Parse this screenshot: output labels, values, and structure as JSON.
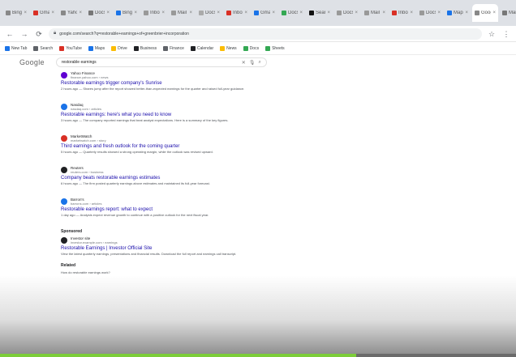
{
  "colors": {
    "link": "#1a0dab",
    "progress": "#7ccd39"
  },
  "browser": {
    "tabs": [
      {
        "label": "Bing",
        "color": "#888888"
      },
      {
        "label": "Gmail",
        "color": "#d93025"
      },
      {
        "label": "Yahoo",
        "color": "#888888"
      },
      {
        "label": "Docs",
        "color": "#777777"
      },
      {
        "label": "Bing",
        "color": "#1a73e8"
      },
      {
        "label": "Inbox",
        "color": "#999999"
      },
      {
        "label": "Mail",
        "color": "#999999"
      },
      {
        "label": "Docs",
        "color": "#aaaaaa"
      },
      {
        "label": "Inbox",
        "color": "#d93025"
      },
      {
        "label": "Gmail",
        "color": "#1a73e8"
      },
      {
        "label": "Docs",
        "color": "#34a853"
      },
      {
        "label": "Search",
        "color": "#111111"
      },
      {
        "label": "Docs",
        "color": "#999999"
      },
      {
        "label": "Mail",
        "color": "#999999"
      },
      {
        "label": "Inbox",
        "color": "#d93025"
      },
      {
        "label": "Docs",
        "color": "#999999"
      },
      {
        "label": "Maps",
        "color": "#1a73e8"
      },
      {
        "label": "Google",
        "color": "#888888",
        "active": true
      },
      {
        "label": "Mail",
        "color": "#777777"
      }
    ],
    "new_tab": "+",
    "url": "google.com/search?q=restorable+earnings+of+greenbrier+incorporation",
    "bookmarks": [
      {
        "label": "New Tab",
        "color": "#1a73e8"
      },
      {
        "label": "Search",
        "color": "#5f6368"
      },
      {
        "label": "YouTube",
        "color": "#d93025"
      },
      {
        "label": "Maps",
        "color": "#1a73e8"
      },
      {
        "label": "Drive",
        "color": "#fbbc04"
      },
      {
        "label": "Business",
        "color": "#202124"
      },
      {
        "label": "Finance",
        "color": "#5f6368"
      },
      {
        "label": "Calendar",
        "color": "#202124"
      },
      {
        "label": "News",
        "color": "#fbbc04"
      },
      {
        "label": "Docs",
        "color": "#34a853"
      },
      {
        "label": "Sheets",
        "color": "#34a853"
      }
    ]
  },
  "google": {
    "logo": "Google",
    "query": "restorable earnings",
    "mic_icon": "mic-icon",
    "camera_icon": "camera-icon",
    "search_icon": "search-icon"
  },
  "results": [
    {
      "site": "Yahoo Finance",
      "url": "finance.yahoo.com › news",
      "title": "Restorable earnings trigger company's Sunrise",
      "snippet": "2 hours ago — Shares jump after the report showed better-than-expected earnings for the quarter and raised full-year guidance.",
      "color": "#6001d2"
    },
    {
      "site": "Nasdaq",
      "url": "nasdaq.com › articles",
      "title": "Restorable earnings: here's what you need to know",
      "snippet": "3 hours ago — The company reported earnings that beat analyst expectations. Here is a summary of the key figures.",
      "color": "#1a73e8"
    },
    {
      "site": "MarketWatch",
      "url": "marketwatch.com › story",
      "title": "Third earnings and fresh outlook for the coming quarter",
      "snippet": "5 hours ago — Quarterly results showed a strong operating margin, while the outlook was revised upward.",
      "color": "#d93025"
    },
    {
      "site": "Reuters",
      "url": "reuters.com › business",
      "title": "Company beats restorable earnings estimates",
      "snippet": "6 hours ago — The firm posted quarterly earnings above estimates and maintained its full-year forecast.",
      "color": "#202124"
    },
    {
      "site": "Barron's",
      "url": "barrons.com › articles",
      "title": "Restorable earnings report: what to expect",
      "snippet": "1 day ago — Analysts expect revenue growth to continue with a positive outlook for the next fiscal year.",
      "color": "#1a73e8"
    }
  ],
  "sponsored": {
    "label": "Sponsored",
    "site": "Investor site",
    "url": "investor.example.com › earnings",
    "title": "Restorable Earnings | Investor Official Site",
    "snippet": "View the latest quarterly earnings, presentations and financial results. Download the full report and earnings call transcript."
  },
  "people_also_ask": {
    "label": "Related",
    "question": "How do restorable earnings work?"
  },
  "progress_fraction": 0.69
}
